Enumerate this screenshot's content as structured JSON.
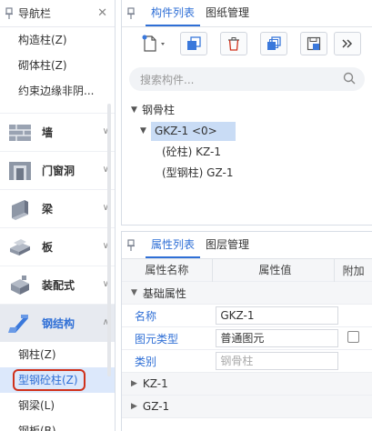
{
  "nav": {
    "title": "导航栏",
    "top_links": [
      "构造柱(Z)",
      "砌体柱(Z)",
      "约束边缘非阴..."
    ],
    "categories": [
      {
        "label": "墙",
        "icon": "wall-icon"
      },
      {
        "label": "门窗洞",
        "icon": "door-window-icon"
      },
      {
        "label": "梁",
        "icon": "beam-icon"
      },
      {
        "label": "板",
        "icon": "slab-icon"
      },
      {
        "label": "装配式",
        "icon": "prefab-icon"
      },
      {
        "label": "钢结构",
        "icon": "steel-structure-icon"
      }
    ],
    "sub_items": [
      "钢柱(Z)",
      "型钢砼柱(Z)",
      "钢梁(L)",
      "钢板(B)"
    ]
  },
  "component_panel": {
    "tabs": [
      "构件列表",
      "图纸管理"
    ],
    "search_placeholder": "搜索构件...",
    "tree": {
      "root": "钢骨柱",
      "selected": "GKZ-1 <0>",
      "children": [
        "(砼柱) KZ-1",
        "(型钢柱) GZ-1"
      ]
    }
  },
  "property_panel": {
    "tabs": [
      "属性列表",
      "图层管理"
    ],
    "headers": [
      "属性名称",
      "属性值",
      "附加"
    ],
    "group": "基础属性",
    "rows": [
      {
        "name": "名称",
        "value": "GKZ-1"
      },
      {
        "name": "图元类型",
        "value": "普通图元"
      },
      {
        "name": "类别",
        "value": "钢骨柱"
      }
    ],
    "collapsed_groups": [
      "KZ-1",
      "GZ-1"
    ]
  },
  "colors": {
    "accent": "#2f6fd6",
    "highlight_box": "#d0311b",
    "selected_row": "#c9dcf5"
  }
}
